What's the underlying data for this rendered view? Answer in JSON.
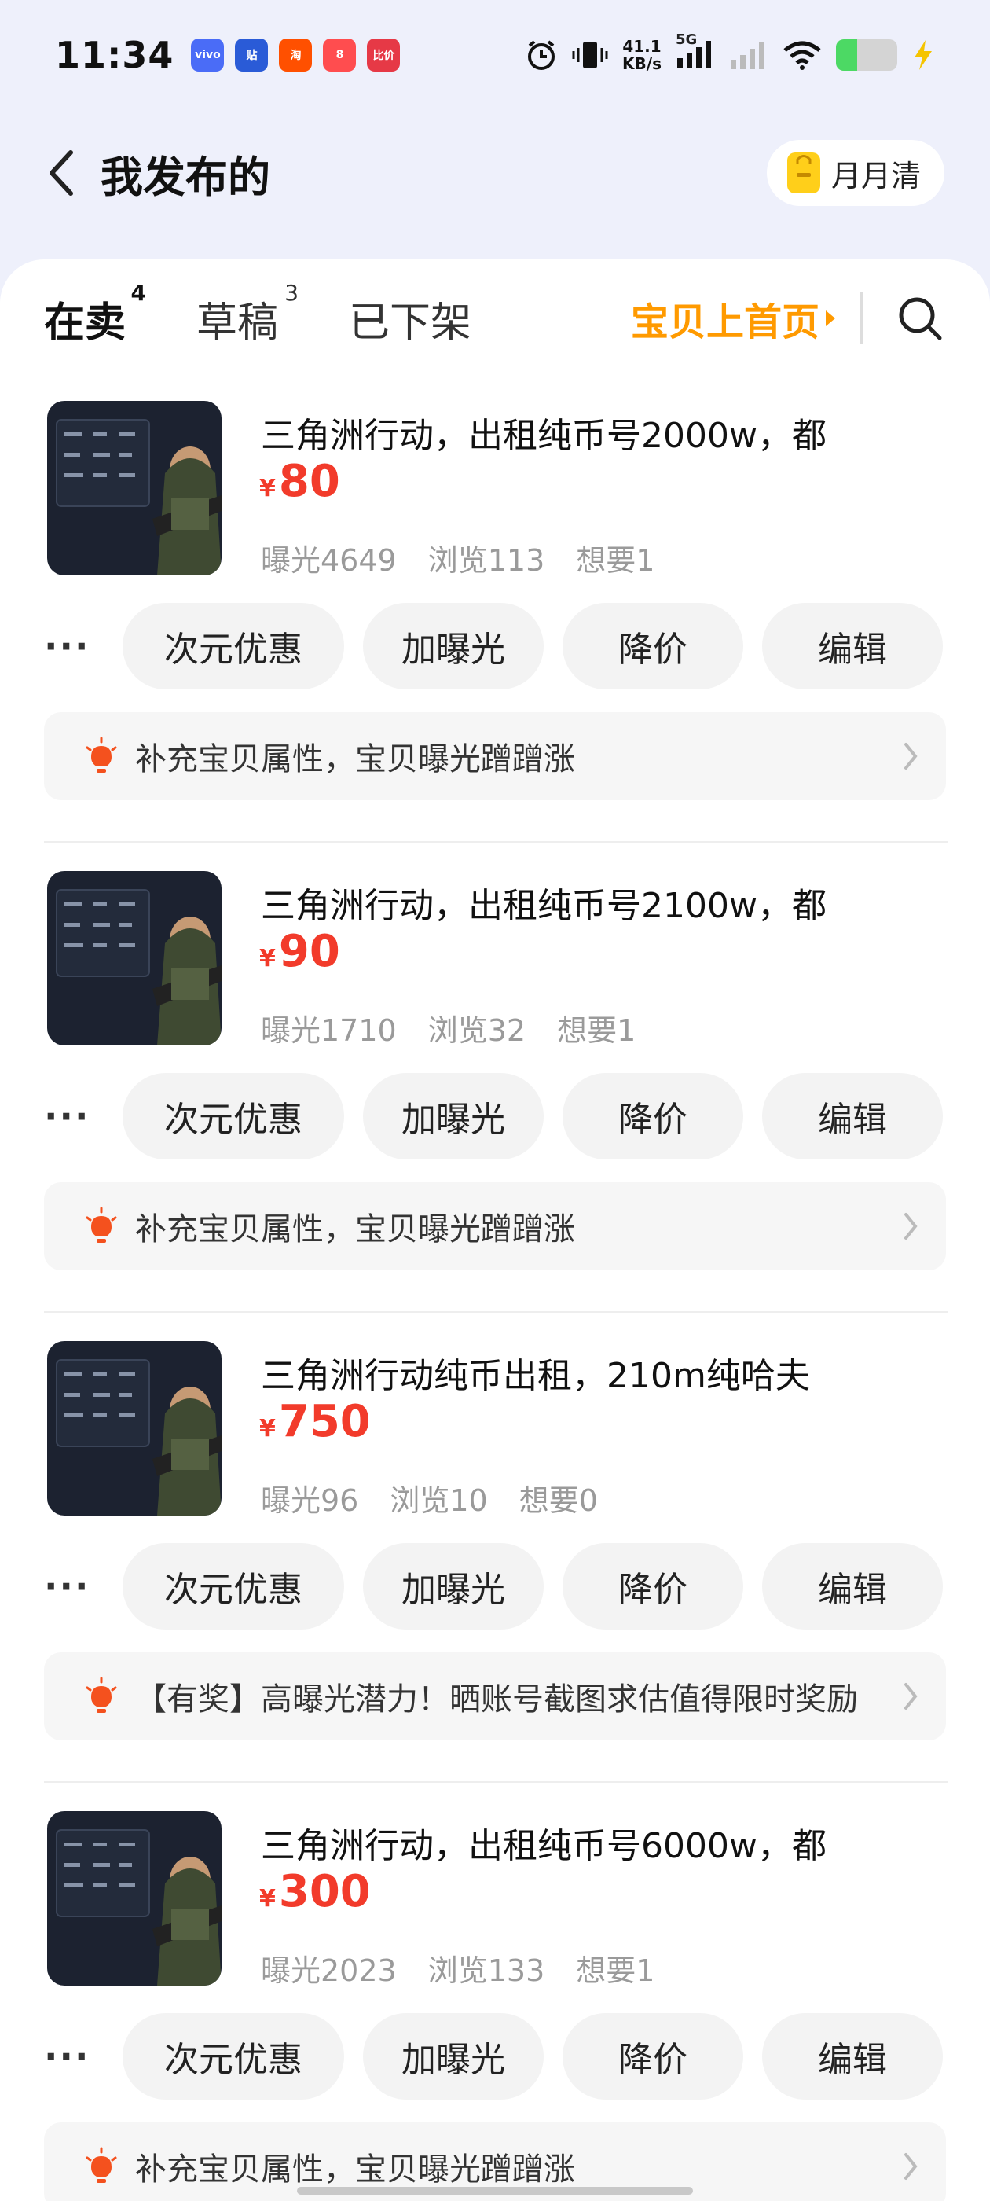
{
  "status_bar": {
    "time": "11:34",
    "apps": [
      {
        "label": "vivo",
        "color": "#4a6cf7"
      },
      {
        "label": "贴",
        "color": "#2a5bd7"
      },
      {
        "label": "淘",
        "color": "#ff5000"
      },
      {
        "label": "8",
        "color": "#ff4d4f"
      },
      {
        "label": "比价",
        "color": "#e63946"
      }
    ],
    "net_speed_value": "41.1",
    "net_speed_unit": "KB/s",
    "network": "5G",
    "battery_level": 0.35
  },
  "header": {
    "title": "我发布的",
    "back_icon": "chevron-left-icon",
    "pill_label": "月月清",
    "pill_icon": "bag-icon",
    "pill_color": "#ffcf1a"
  },
  "tabs": [
    {
      "label": "在卖",
      "count": "4",
      "active": true
    },
    {
      "label": "草稿",
      "count": "3",
      "active": false
    },
    {
      "label": "已下架",
      "count": "",
      "active": false
    }
  ],
  "promo_link": {
    "label": "宝贝上首页",
    "color": "#ff9a00"
  },
  "search_icon": "search-icon",
  "more_label": "···",
  "actions": [
    "次元优惠",
    "加曝光",
    "降价",
    "编辑"
  ],
  "listings": [
    {
      "title": "三角洲行动，出租纯币号2000w，都",
      "currency": "¥",
      "price": "80",
      "stats": [
        "曝光4649",
        "浏览113",
        "想要1"
      ],
      "tip": "补充宝贝属性，宝贝曝光蹭蹭涨"
    },
    {
      "title": "三角洲行动，出租纯币号2100w，都",
      "currency": "¥",
      "price": "90",
      "stats": [
        "曝光1710",
        "浏览32",
        "想要1"
      ],
      "tip": "补充宝贝属性，宝贝曝光蹭蹭涨"
    },
    {
      "title": "三角洲行动纯币出租，210m纯哈夫",
      "currency": "¥",
      "price": "750",
      "stats": [
        "曝光96",
        "浏览10",
        "想要0"
      ],
      "tip": "【有奖】高曝光潜力！晒账号截图求估值得限时奖励"
    },
    {
      "title": "三角洲行动，出租纯币号6000w，都",
      "currency": "¥",
      "price": "300",
      "stats": [
        "曝光2023",
        "浏览133",
        "想要1"
      ],
      "tip": "补充宝贝属性，宝贝曝光蹭蹭涨"
    }
  ],
  "colors": {
    "price": "#f23b2b",
    "tab_highlight": "#ffe033",
    "background": "#eef0fb"
  }
}
